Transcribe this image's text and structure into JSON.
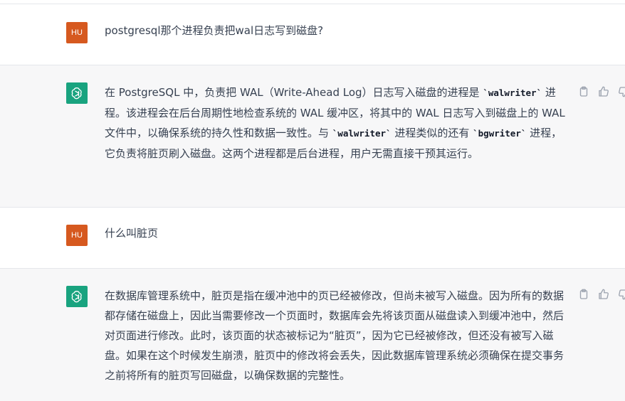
{
  "messages": [
    {
      "role": "user",
      "avatar": "HU",
      "text": "postgresql那个进程负责把wal日志写到磁盘?"
    },
    {
      "role": "assistant",
      "avatar": "openai-logo-icon",
      "parts": {
        "a": "在 PostgreSQL 中，负责把 WAL（Write-Ahead Log）日志写入磁盘的进程是 ",
        "code1": "`walwriter`",
        "b": " 进程。该进程会在后台周期性地检查系统的 WAL 缓冲区，将其中的 WAL 日志写入到磁盘上的 WAL 文件中，以确保系统的持久性和数据一致性。与 ",
        "code2": "`walwriter`",
        "c": " 进程类似的还有 ",
        "code3": "`bgwriter`",
        "d": " 进程，它负责将脏页刷入磁盘。这两个进程都是后台进程，用户无需直接干预其运行。"
      }
    },
    {
      "role": "user",
      "avatar": "HU",
      "text": "什么叫脏页"
    },
    {
      "role": "assistant",
      "avatar": "openai-logo-icon",
      "text": "在数据库管理系统中，脏页是指在缓冲池中的页已经被修改，但尚未被写入磁盘。因为所有的数据都存储在磁盘上，因此当需要修改一个页面时，数据库会先将该页面从磁盘读入到缓冲池中，然后对页面进行修改。此时，该页面的状态被标记为“脏页”，因为它已经被修改，但还没有被写入磁盘。如果在这个时候发生崩溃，脏页中的修改将会丢失，因此数据库管理系统必须确保在提交事务之前将所有的脏页写回磁盘，以确保数据的完整性。"
    }
  ],
  "actions": [
    "copy-icon",
    "thumbs-up-icon",
    "thumbs-down-icon"
  ],
  "colors": {
    "user_avatar": "#d6591f",
    "bot_avatar": "#19a37f",
    "assistant_bg": "#f7f7f8",
    "text": "#374151"
  }
}
